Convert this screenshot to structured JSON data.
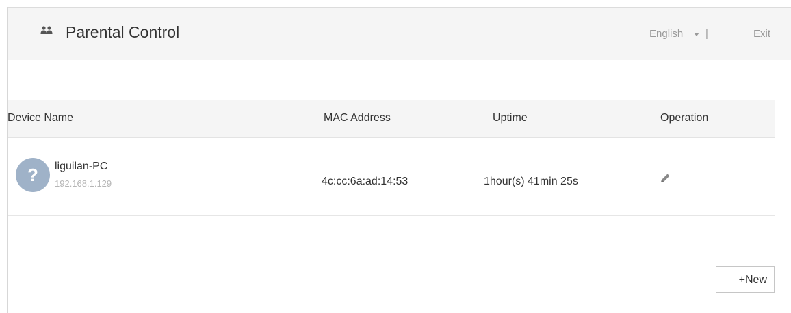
{
  "header": {
    "title": "Parental Control",
    "title_icon": "users-icon",
    "language": "English",
    "separator": "|",
    "exit_label": "Exit"
  },
  "table": {
    "columns": [
      "Device Name",
      "MAC Address",
      "Uptime",
      "Operation"
    ],
    "rows": [
      {
        "avatar_glyph": "?",
        "device_name": "liguilan-PC",
        "ip": "192.168.1.129",
        "mac": "4c:cc:6a:ad:14:53",
        "uptime": "1hour(s) 41min 25s",
        "operation_icon": "edit-pencil-icon"
      }
    ]
  },
  "actions": {
    "new_label": "+New"
  },
  "colors": {
    "header_bg": "#f5f5f5",
    "avatar_bg": "#9fb2c8",
    "muted_text": "#9a9a9a"
  }
}
